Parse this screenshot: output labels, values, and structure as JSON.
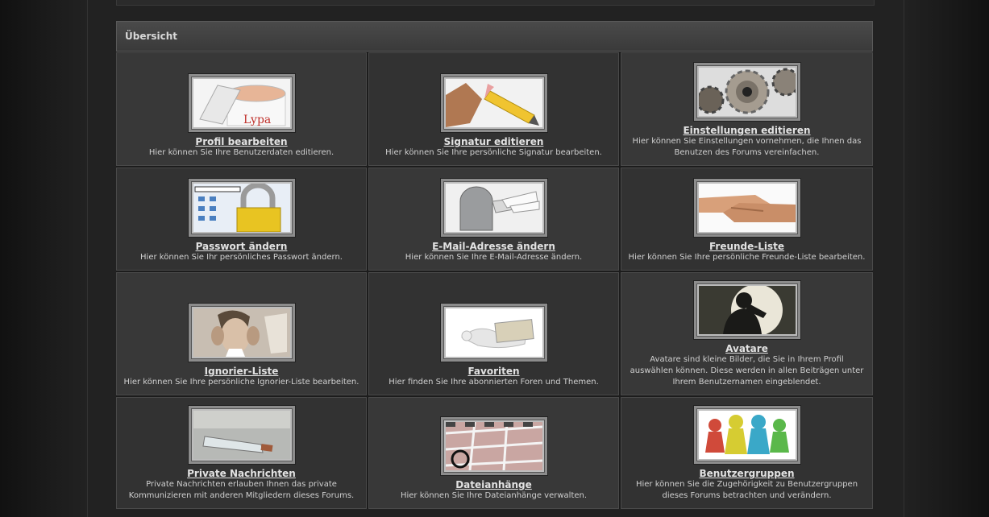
{
  "header": {
    "title": "Übersicht"
  },
  "items": [
    {
      "id": "profil",
      "label": "Profil bearbeiten",
      "desc": "Hier können Sie Ihre Benutzerdaten editieren.",
      "image_text": "Lypa",
      "icon": "cream-jar-icon"
    },
    {
      "id": "signatur",
      "label": "Signatur editieren",
      "desc": "Hier können Sie Ihre persönliche Signatur bearbeiten.",
      "icon": "pencil-hand-icon"
    },
    {
      "id": "einstellungen",
      "label": "Einstellungen editieren",
      "desc": "Hier können Sie Einstellungen vornehmen, die Ihnen das Benutzen des Forums vereinfachen.",
      "icon": "gears-icon"
    },
    {
      "id": "passwort",
      "label": "Passwort ändern",
      "desc": "Hier können Sie Ihr persönliches Passwort ändern.",
      "icon": "padlock-icon"
    },
    {
      "id": "email",
      "label": "E-Mail-Adresse ändern",
      "desc": "Hier können Sie Ihre E-Mail-Adresse ändern.",
      "icon": "mailbox-icon"
    },
    {
      "id": "freunde",
      "label": "Freunde-Liste",
      "desc": "Hier können Sie Ihre persönliche Freunde-Liste bearbeiten.",
      "icon": "handshake-icon"
    },
    {
      "id": "ignorier",
      "label": "Ignorier-Liste",
      "desc": "Hier können Sie Ihre persönliche Ignorier-Liste bearbeiten.",
      "icon": "covered-ears-icon"
    },
    {
      "id": "favoriten",
      "label": "Favoriten",
      "desc": "Hier finden Sie Ihre abonnierten Foren und Themen.",
      "icon": "dove-letter-icon"
    },
    {
      "id": "avatare",
      "label": "Avatare",
      "desc": "Avatare sind kleine Bilder, die Sie in Ihrem Profil auswählen können. Diese werden in allen Beiträgen unter Ihrem Benutzernamen eingeblendet.",
      "icon": "silhouette-icon"
    },
    {
      "id": "nachrichten",
      "label": "Private Nachrichten",
      "desc": "Private Nachrichten erlauben Ihnen das private Kommunizieren mit anderen Mitgliedern dieses Forums.",
      "icon": "bottle-message-icon"
    },
    {
      "id": "dateianhaenge",
      "label": "Dateianhänge",
      "desc": "Hier können Sie Ihre Dateianhänge verwalten.",
      "icon": "hopscotch-icon"
    },
    {
      "id": "benutzergruppen",
      "label": "Benutzergruppen",
      "desc": "Hier können Sie die Zugehörigkeit zu Benutzergruppen dieses Forums betrachten und verändern.",
      "icon": "game-pieces-icon"
    }
  ]
}
